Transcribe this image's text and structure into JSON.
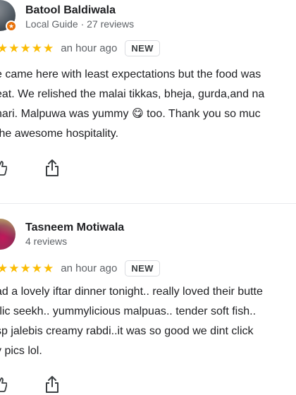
{
  "reviews": [
    {
      "author": "Batool Baldiwala",
      "meta": "Local Guide · 27 reviews",
      "rating": 5,
      "time": "an hour ago",
      "badge": "NEW",
      "text_lines": [
        "e came here with least expectations but the food was",
        "eat. We relished the malai tikkas, bheja, gurda,and na",
        "nari. Malpuwa was yummy 😋 too. Thank you so muc",
        "the awesome hospitality."
      ],
      "icons": [
        "local-guide-badge-icon",
        "thumbs-up-icon",
        "share-icon"
      ]
    },
    {
      "author": "Tasneem Motiwala",
      "meta": "4 reviews",
      "rating": 5,
      "time": "an hour ago",
      "badge": "NEW",
      "text_lines": [
        "ad a lovely iftar dinner tonight.. really loved their butte",
        "rlic seekh.. yummylicious malpuas.. tender soft fish..",
        "sp jalebis creamy rabdi..it was so good we dint click",
        "y pics lol."
      ],
      "icons": [
        "thumbs-up-icon",
        "share-icon"
      ]
    }
  ],
  "colors": {
    "star": "#fbbc04",
    "secondary_text": "#5f6368",
    "guide_badge": "#e8710a"
  }
}
